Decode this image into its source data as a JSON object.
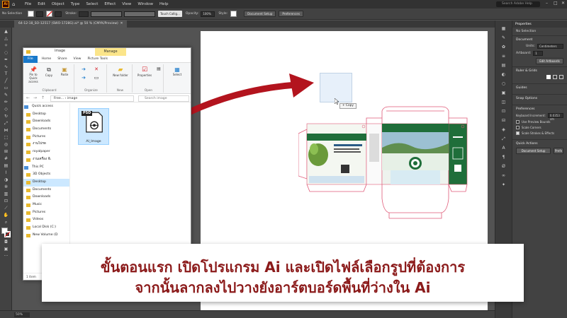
{
  "menubar": {
    "logo": "Ai",
    "items": [
      "File",
      "Edit",
      "Object",
      "Type",
      "Select",
      "Effect",
      "View",
      "Window",
      "Help"
    ],
    "search_placeholder": "Search Adobe Help"
  },
  "controlbar": {
    "selection": "No Selection",
    "stroke_label": "Stroke:",
    "brush": "Touch Callig...",
    "opacity_label": "Opacity:",
    "opacity_value": "100%",
    "style_label": "Style:",
    "doc_setup": "Document Setup",
    "preferences": "Preferences"
  },
  "doc_tab": "64-12-18_SO-12517 (SWO-1728G).ai* @ 50 % (CMYK/Preview)",
  "status": {
    "zoom": "50%"
  },
  "panel": {
    "tab_properties": "Properties",
    "no_selection": "No Selection",
    "document": "Document",
    "units_label": "Units:",
    "units_value": "Centimeters",
    "artboard_label": "Artboard:",
    "artboard_value": "1",
    "edit_artboards": "Edit Artboards",
    "ruler_grids": "Ruler & Grids",
    "guides": "Guides",
    "snap_options": "Snap Options",
    "preferences": "Preferences",
    "keyboard_increment_label": "Keyboard Increment:",
    "keyboard_increment_value": "0.0353 cm",
    "use_preview_bounds": "Use Preview Bounds",
    "scale_corners": "Scale Corners",
    "scale_strokes": "Scale Strokes & Effects",
    "quick_actions": "Quick Actions",
    "document_setup": "Document Setup",
    "prefs_btn": "Prefe"
  },
  "explorer": {
    "title_path": "image",
    "manage": "Manage",
    "tabs": [
      "File",
      "Home",
      "Share",
      "View",
      "Picture Tools"
    ],
    "ribbon": {
      "pin": "Pin to Quick access",
      "copy": "Copy",
      "paste": "Paste",
      "clipboard": "Clipboard",
      "organize": "Organize",
      "new_folder": "New folder",
      "new": "New",
      "properties": "Properties",
      "open": "Open",
      "select": "Select"
    },
    "address": "Free...  ›  image",
    "search_placeholder": "Search image",
    "nav": [
      {
        "label": "Quick access",
        "head": true
      },
      {
        "label": "Desktop"
      },
      {
        "label": "Downloads"
      },
      {
        "label": "Documents"
      },
      {
        "label": "Pictures"
      },
      {
        "label": "งานโปรด"
      },
      {
        "label": "royalpaper"
      },
      {
        "label": "งานเครื่อง จีเ"
      },
      {
        "label": "This PC",
        "head": true
      },
      {
        "label": "3D Objects"
      },
      {
        "label": "Desktop",
        "selected": true
      },
      {
        "label": "Documents"
      },
      {
        "label": "Downloads"
      },
      {
        "label": "Music"
      },
      {
        "label": "Pictures"
      },
      {
        "label": "Videos"
      },
      {
        "label": "Local Disk (C:)"
      },
      {
        "label": "New Volume (D"
      }
    ],
    "file": {
      "badge": "PSD",
      "name": "AI_Image"
    },
    "status": "1 item"
  },
  "copy_tooltip": "+ Copy",
  "caption": {
    "line1": "ขั้นตอนแรก เปิดโปรแกรม Ai และเปิดไฟล์เลือกรูปที่ต้องการ",
    "line2": "จากนั้นลากลงไปวางยังอาร์ตบอร์ดพื้นที่ว่างใน Ai"
  },
  "colors": {
    "caption_text": "#8b1a1a",
    "arrow": "#b3141e",
    "package_green": "#1f6e3a",
    "dieline": "#e05a78",
    "file_tab": "#1979ca",
    "manage_tab": "#fbe58a"
  }
}
